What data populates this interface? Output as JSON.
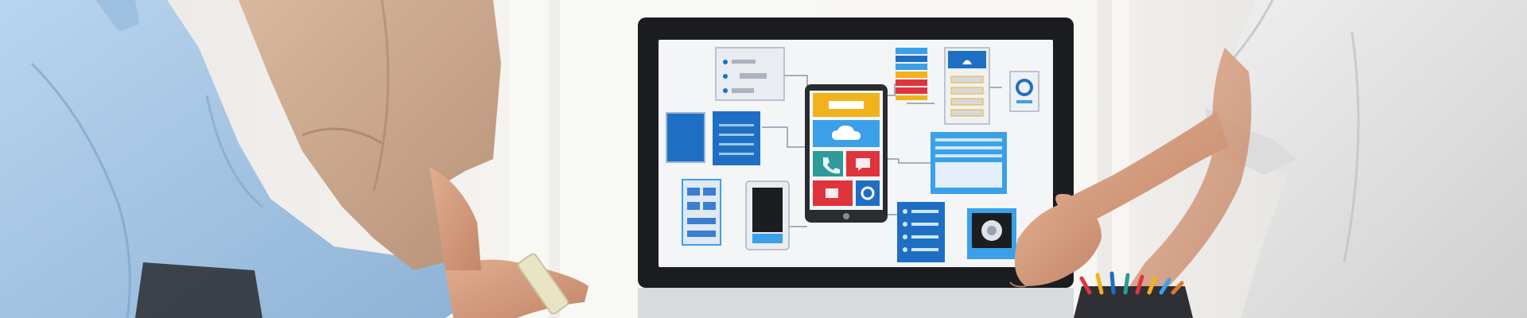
{
  "scene": {
    "subject": "team-reviewing-app-wireframe",
    "colors": {
      "background": "#f3f1ee",
      "monitor_bezel": "#1c1d20",
      "screen": "#f4f5f7",
      "wire_blue": "#1e6fc4",
      "wire_light_blue": "#3aa0e8",
      "accent_red": "#e0343c",
      "accent_yellow": "#f2b21b",
      "accent_teal": "#2f9a9a",
      "shirt_light_blue": "#a9c9e6",
      "shirt_beige": "#c9a78c",
      "shirt_white": "#e7e7e7",
      "skin": "#d49b7c"
    },
    "icons": [
      "cloud-icon",
      "phone-icon",
      "headphones-icon",
      "video-icon",
      "chat-icon",
      "profile-icon",
      "location-icon"
    ]
  }
}
